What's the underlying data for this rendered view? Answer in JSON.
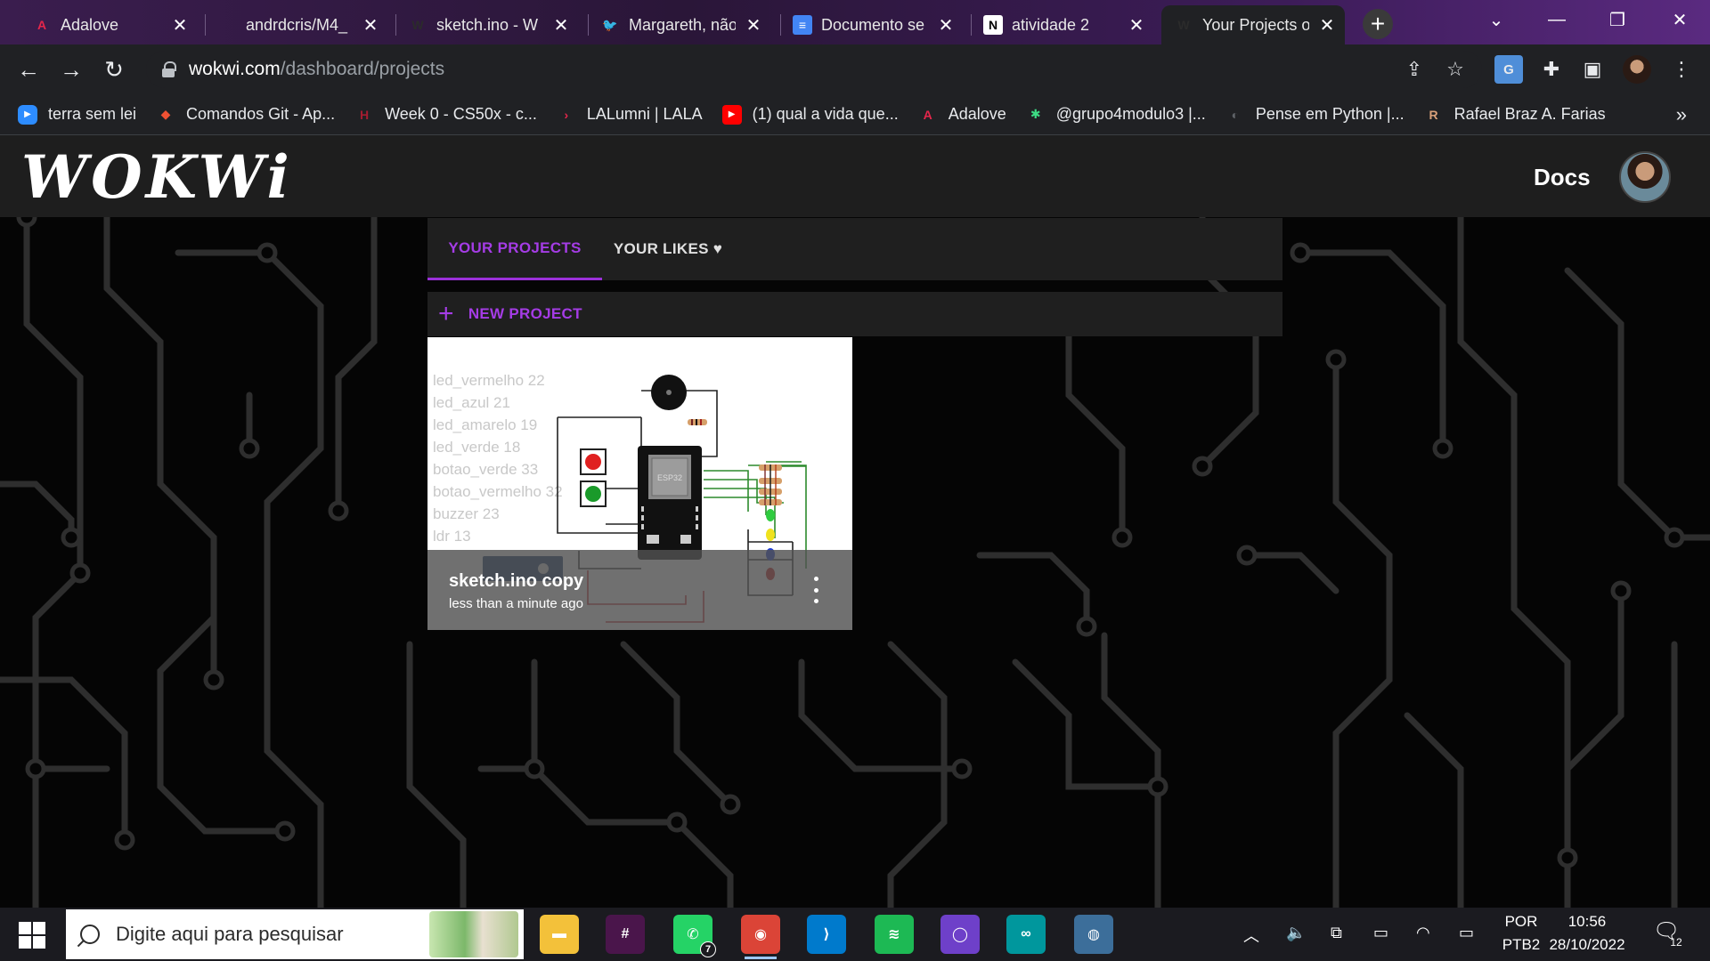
{
  "browser": {
    "tabs": [
      {
        "title": "Adalove",
        "icon": "adalove-icon",
        "color": "#e5264b",
        "glyph": "A",
        "active": false
      },
      {
        "title": "andrdcris/M4_",
        "icon": "github-icon",
        "color": "#2b2b2b",
        "glyph": "",
        "active": false
      },
      {
        "title": "sketch.ino - W",
        "icon": "wokwi-icon",
        "color": "#2b2b2b",
        "glyph": "W",
        "active": false
      },
      {
        "title": "Margareth, não",
        "icon": "twitter-icon",
        "color": "#1d9bf0",
        "glyph": "🐦",
        "active": false
      },
      {
        "title": "Documento se",
        "icon": "google-docs-icon",
        "color": "#4285f4",
        "glyph": "≡",
        "active": false
      },
      {
        "title": "atividade 2",
        "icon": "notion-icon",
        "color": "#ffffff",
        "glyph": "N",
        "active": false
      },
      {
        "title": "Your Projects o",
        "icon": "wokwi-icon",
        "color": "#2b2b2b",
        "glyph": "W",
        "active": true
      }
    ],
    "new_tab": "+",
    "url_host": "wokwi.com",
    "url_path": "/dashboard/projects",
    "bookmarks": [
      {
        "label": "terra sem lei",
        "icon": "zoom-icon",
        "color": "#2d8cff",
        "glyph": "▶"
      },
      {
        "label": "Comandos Git - Ap...",
        "icon": "git-icon",
        "color": "#f05133",
        "glyph": "◆"
      },
      {
        "label": "Week 0 - CS50x - c...",
        "icon": "harvard-icon",
        "color": "#a51c30",
        "glyph": "H"
      },
      {
        "label": "LALumni | LALA",
        "icon": "lala-icon",
        "color": "#e5264b",
        "glyph": "›"
      },
      {
        "label": "(1) qual a vida que...",
        "icon": "youtube-icon",
        "color": "#ff0000",
        "glyph": "▶"
      },
      {
        "label": "Adalove",
        "icon": "adalove-icon",
        "color": "#e5264b",
        "glyph": "A"
      },
      {
        "label": "@grupo4modulo3 |...",
        "icon": "asterisk-icon",
        "color": "#3ddc84",
        "glyph": "✱"
      },
      {
        "label": "Pense em Python |...",
        "icon": "globe-icon",
        "color": "#5f6368",
        "glyph": "◐"
      },
      {
        "label": "Rafael Braz A. Farias",
        "icon": "profile-bookmark-icon",
        "color": "#d9a07a",
        "glyph": "R"
      }
    ],
    "bookmarks_more": "»"
  },
  "wokwi": {
    "logo": "WOKWi",
    "docs": "Docs",
    "tab_projects": "YOUR PROJECTS",
    "tab_likes": "YOUR LIKES ♥",
    "new_project": "NEW PROJECT",
    "accent": "#9b30d9",
    "card": {
      "title": "sketch.ino copy",
      "subtitle": "less than a minute ago",
      "code_lines": [
        "led_vermelho 22",
        "led_azul 21",
        "led_amarelo 19",
        "led_verde 18",
        "botao_verde 33",
        "botao_vermelho 32",
        "buzzer 23",
        "ldr 13"
      ],
      "chip_label": "ESP32"
    }
  },
  "taskbar": {
    "search_placeholder": "Digite aqui para pesquisar",
    "apps": [
      {
        "name": "file-explorer-icon",
        "color": "#f3c13a",
        "glyph": "▬"
      },
      {
        "name": "slack-icon",
        "color": "#4a154b",
        "glyph": "#"
      },
      {
        "name": "whatsapp-icon",
        "color": "#25d366",
        "glyph": "✆",
        "badge": "7"
      },
      {
        "name": "chrome-icon",
        "color": "#db4437",
        "glyph": "◉"
      },
      {
        "name": "vscode-icon",
        "color": "#007acc",
        "glyph": "⟩"
      },
      {
        "name": "spotify-icon",
        "color": "#1db954",
        "glyph": "≋"
      },
      {
        "name": "github-desktop-icon",
        "color": "#6e40c9",
        "glyph": "◯"
      },
      {
        "name": "arduino-icon",
        "color": "#00979d",
        "glyph": "∞"
      },
      {
        "name": "setup-icon",
        "color": "#3c6e9a",
        "glyph": "◍"
      }
    ],
    "lang_top": "POR",
    "lang_bottom": "PTB2",
    "time": "10:56",
    "date": "28/10/2022",
    "notifications": "12"
  }
}
